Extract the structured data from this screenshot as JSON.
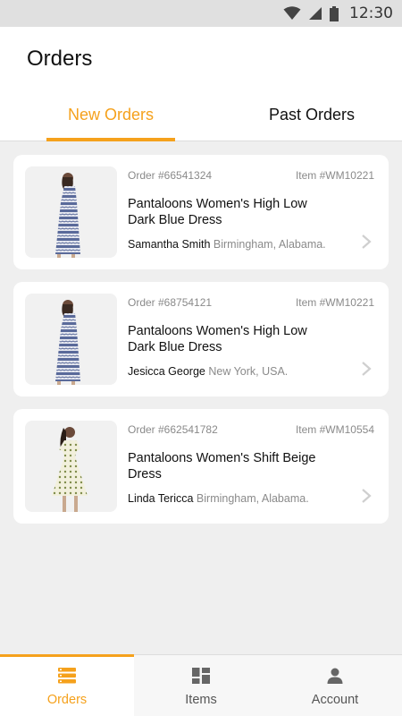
{
  "status_bar": {
    "time": "12:30",
    "icons": [
      "wifi-icon",
      "signal-icon",
      "battery-icon"
    ]
  },
  "header": {
    "title": "Orders"
  },
  "tabs": [
    {
      "label": "New Orders",
      "active": true
    },
    {
      "label": "Past Orders",
      "active": false
    }
  ],
  "orders": [
    {
      "order": "Order #66541324",
      "item": "Item #WM10221",
      "product": "Pantaloons Women's High Low Dark Blue Dress",
      "customer": "Samantha Smith",
      "location": "Birmingham, Alabama."
    },
    {
      "order": "Order #68754121",
      "item": "Item #WM10221",
      "product": "Pantaloons Women's High Low Dark Blue Dress",
      "customer": "Jesicca George",
      "location": "New York, USA."
    },
    {
      "order": "Order #662541782",
      "item": "Item #WM10554",
      "product": "Pantaloons Women's Shift Beige Dress",
      "customer": "Linda Tericca",
      "location": "Birmingham, Alabama."
    }
  ],
  "bottom_nav": [
    {
      "label": "Orders",
      "icon": "list-icon",
      "active": true
    },
    {
      "label": "Items",
      "icon": "grid-icon",
      "active": false
    },
    {
      "label": "Account",
      "icon": "person-icon",
      "active": false
    }
  ],
  "colors": {
    "accent": "#f5a11c",
    "background": "#efefef",
    "card": "#ffffff",
    "muted_text": "#8a8a8a"
  }
}
